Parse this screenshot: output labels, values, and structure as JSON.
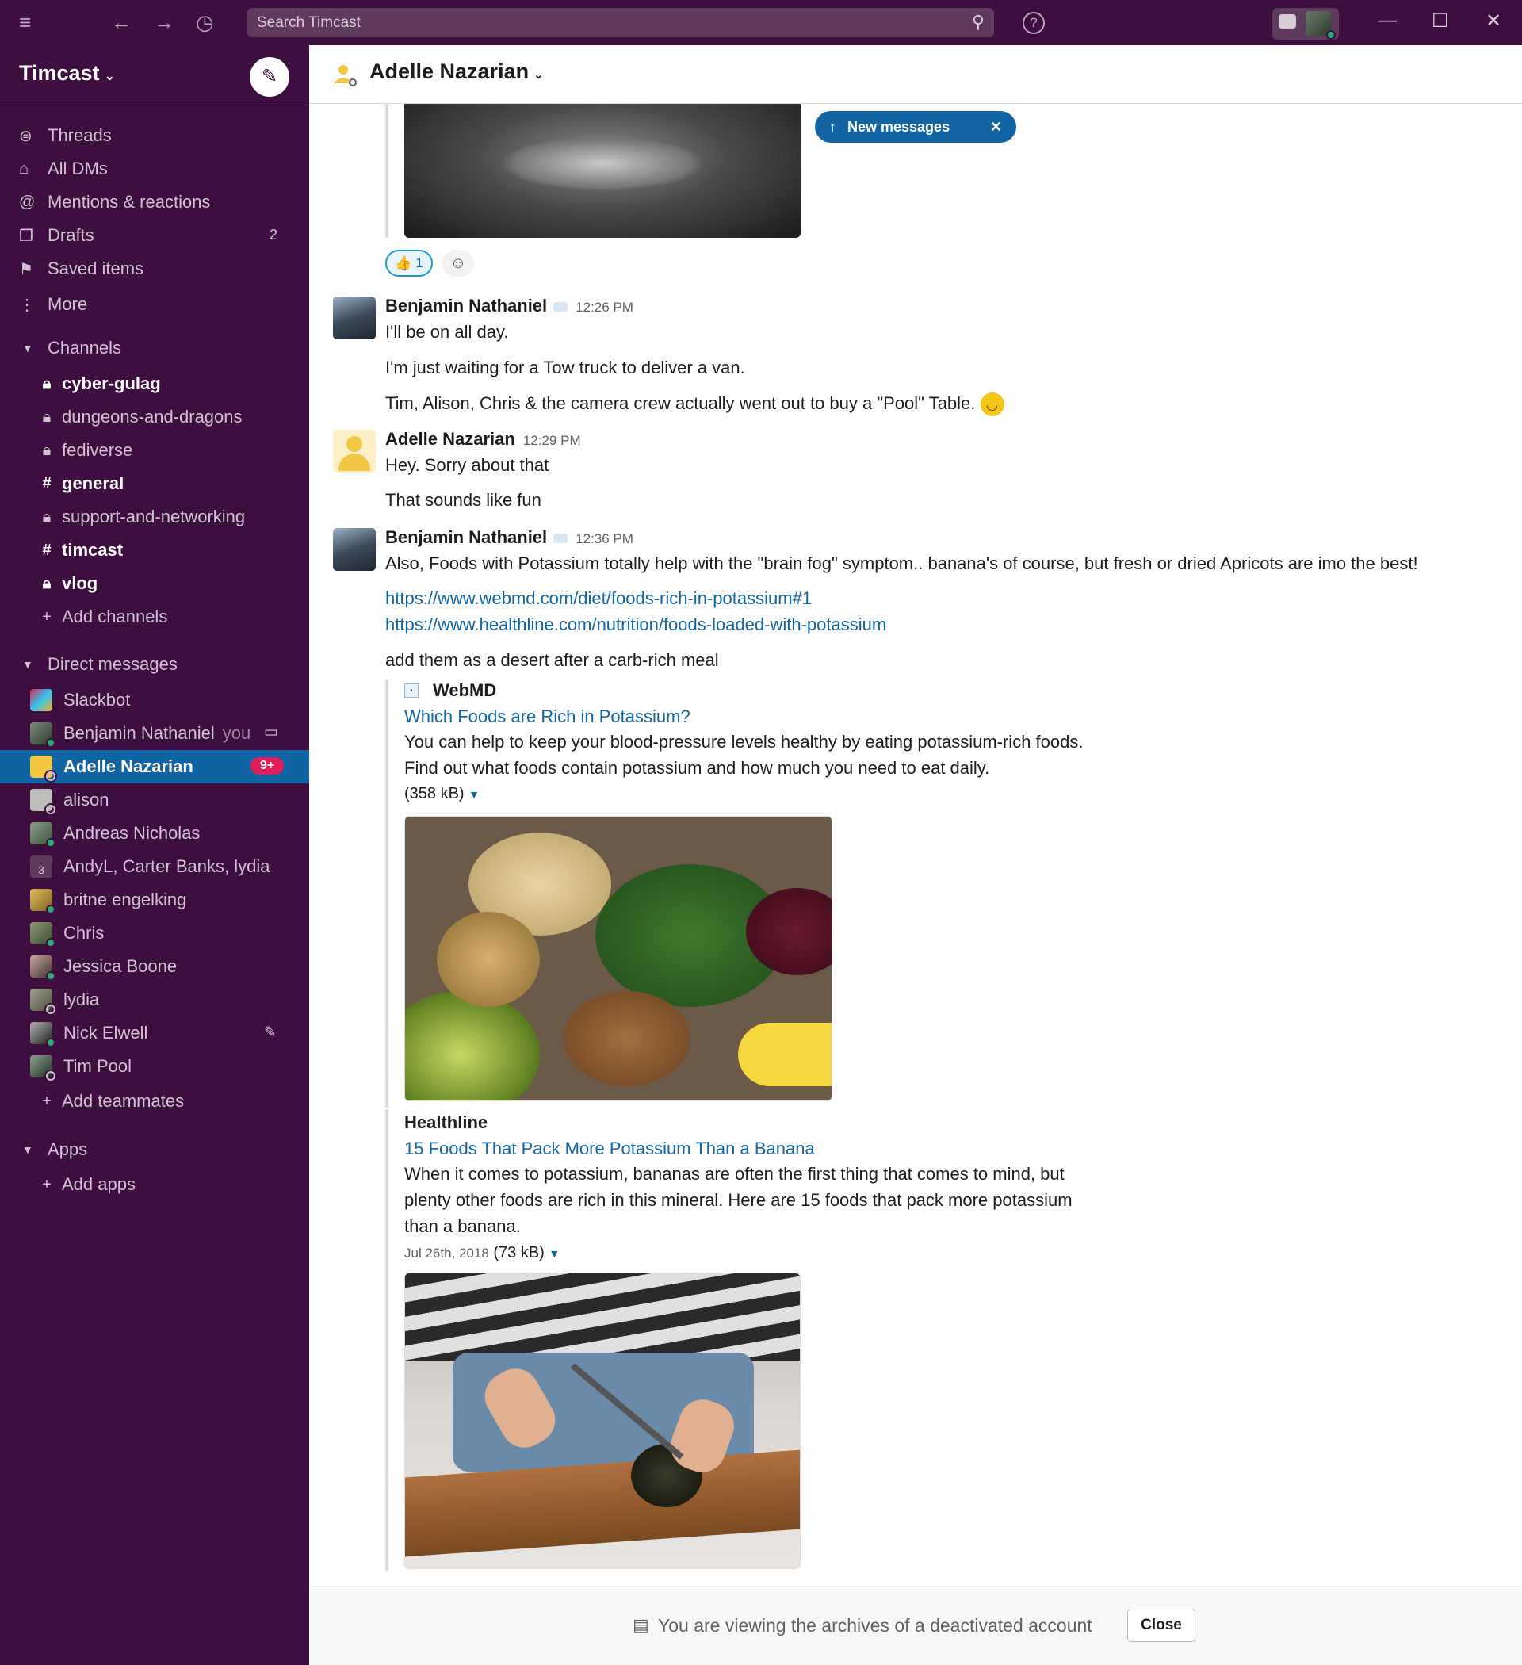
{
  "titlebar": {
    "search_placeholder": "Search Timcast",
    "help_label": "?"
  },
  "workspace": {
    "name": "Timcast"
  },
  "nav": [
    {
      "label": "Threads",
      "icon": "threads-icon"
    },
    {
      "label": "All DMs",
      "icon": "all-dms-icon"
    },
    {
      "label": "Mentions & reactions",
      "icon": "at-icon"
    },
    {
      "label": "Drafts",
      "icon": "drafts-icon",
      "count": "2"
    },
    {
      "label": "Saved items",
      "icon": "bookmark-icon"
    },
    {
      "label": "More",
      "icon": "more-icon"
    }
  ],
  "channels_header": "Channels",
  "channels": [
    {
      "name": "cyber-gulag",
      "type": "private",
      "unread": true
    },
    {
      "name": "dungeons-and-dragons",
      "type": "private",
      "unread": false
    },
    {
      "name": "fediverse",
      "type": "private",
      "unread": false
    },
    {
      "name": "general",
      "type": "public",
      "unread": true
    },
    {
      "name": "support-and-networking",
      "type": "private",
      "unread": false
    },
    {
      "name": "timcast",
      "type": "public",
      "unread": true
    },
    {
      "name": "vlog",
      "type": "private",
      "unread": true
    }
  ],
  "add_channels": "Add channels",
  "dms_header": "Direct messages",
  "dms": [
    {
      "name": "Slackbot"
    },
    {
      "name": "Benjamin Nathaniel",
      "suffix": "you"
    },
    {
      "name": "Adelle Nazarian",
      "badge": "9+",
      "active": true
    },
    {
      "name": "alison"
    },
    {
      "name": "Andreas Nicholas"
    },
    {
      "name": "AndyL, Carter Banks, lydia",
      "group_count": "3"
    },
    {
      "name": "britne engelking"
    },
    {
      "name": "Chris"
    },
    {
      "name": "Jessica Boone"
    },
    {
      "name": "lydia"
    },
    {
      "name": "Nick Elwell"
    },
    {
      "name": "Tim Pool"
    }
  ],
  "add_teammates": "Add teammates",
  "apps_header": "Apps",
  "add_apps": "Add apps",
  "header": {
    "title": "Adelle Nazarian"
  },
  "new_messages_label": "New messages",
  "reaction": {
    "emoji": "👍",
    "count": "1"
  },
  "messages": {
    "m1": {
      "sender": "Benjamin Nathaniel",
      "time": "12:26 PM",
      "lines": [
        "I'll be on all day.",
        "I'm just waiting for a Tow truck to deliver a van.",
        "Tim, Alison, Chris & the camera crew actually went out to buy a \"Pool\" Table."
      ]
    },
    "m2": {
      "sender": "Adelle Nazarian",
      "time": "12:29 PM",
      "lines": [
        "Hey. Sorry about that",
        "That sounds like fun"
      ]
    },
    "m3": {
      "sender": "Benjamin Nathaniel",
      "time": "12:36 PM",
      "lines": [
        "Also, Foods with Potassium totally help with the \"brain fog\" symptom.. banana's of course, but fresh or dried Apricots are imo the best!",
        "add them as a desert after a carb-rich meal"
      ],
      "links": [
        "https://www.webmd.com/diet/foods-rich-in-potassium#1",
        "https://www.healthline.com/nutrition/foods-loaded-with-potassium"
      ]
    }
  },
  "unfurls": {
    "webmd": {
      "site": "WebMD",
      "title": "Which Foods are Rich in Potassium?",
      "desc": "You can help to keep your blood-pressure levels healthy by eating potassium-rich foods. Find out what foods contain potassium and how much you need to eat daily.",
      "size": "(358 kB)"
    },
    "healthline": {
      "site": "Healthline",
      "title": "15 Foods That Pack More Potassium Than a Banana",
      "desc": "When it comes to potassium, bananas are often the first thing that comes to mind, but plenty other foods are rich in this mineral. Here are 15 foods that pack more potassium than a banana.",
      "date": "Jul 26th, 2018",
      "size": "(73 kB)"
    }
  },
  "footer": {
    "text": "You are viewing the archives of a deactivated account",
    "close_label": "Close"
  }
}
